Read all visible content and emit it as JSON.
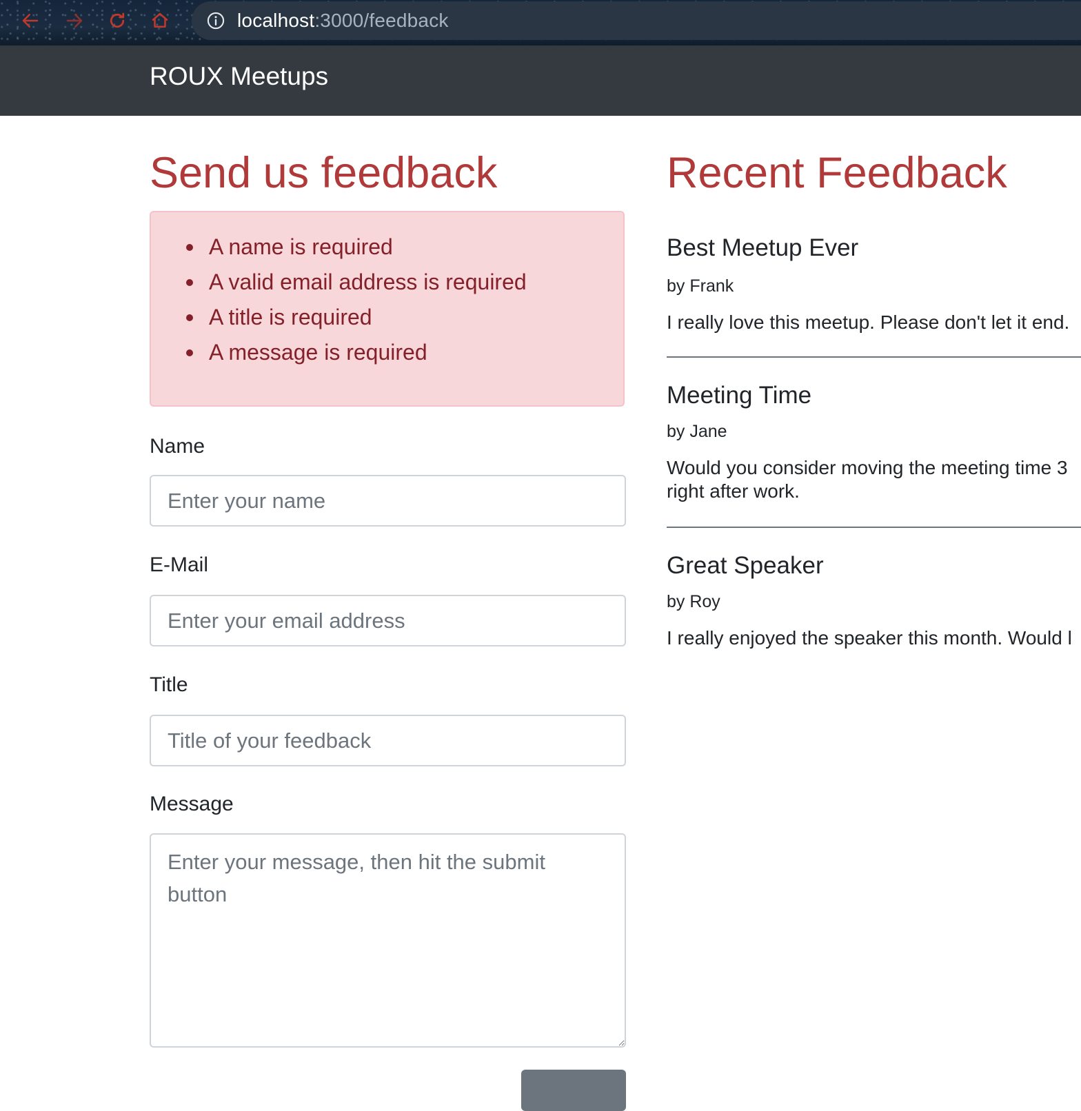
{
  "browser": {
    "url_host": "localhost",
    "url_path": ":3000/feedback"
  },
  "navbar": {
    "brand": "ROUX Meetups"
  },
  "form_section": {
    "title": "Send us feedback",
    "errors": [
      "A name is required",
      "A valid email address is required",
      "A title is required",
      "A message is required"
    ],
    "fields": {
      "name": {
        "label": "Name",
        "placeholder": "Enter your name",
        "value": ""
      },
      "email": {
        "label": "E-Mail",
        "placeholder": "Enter your email address",
        "value": ""
      },
      "title": {
        "label": "Title",
        "placeholder": "Title of your feedback",
        "value": ""
      },
      "message": {
        "label": "Message",
        "placeholder": "Enter your message, then hit the submit button",
        "value": ""
      }
    },
    "submit_label": ""
  },
  "feedback_section": {
    "title": "Recent Feedback",
    "items": [
      {
        "title": "Best Meetup Ever",
        "author": "by Frank",
        "message": "I really love this meetup. Please don't let it end."
      },
      {
        "title": "Meeting Time",
        "author": "by Jane",
        "message": "Would you consider moving the meeting time 3 right after work."
      },
      {
        "title": "Great Speaker",
        "author": "by Roy",
        "message": "I really enjoyed the speaker this month. Would l"
      }
    ]
  },
  "colors": {
    "accent": "#b03a3a",
    "navbar_bg": "#343a40",
    "alert_bg": "#f8d7da",
    "alert_text": "#842029",
    "browser_icon": "#c0392b"
  },
  "icons": {
    "back": "back-arrow-icon",
    "forward": "forward-arrow-icon",
    "reload": "reload-icon",
    "home": "home-icon",
    "site_info": "info-icon"
  }
}
